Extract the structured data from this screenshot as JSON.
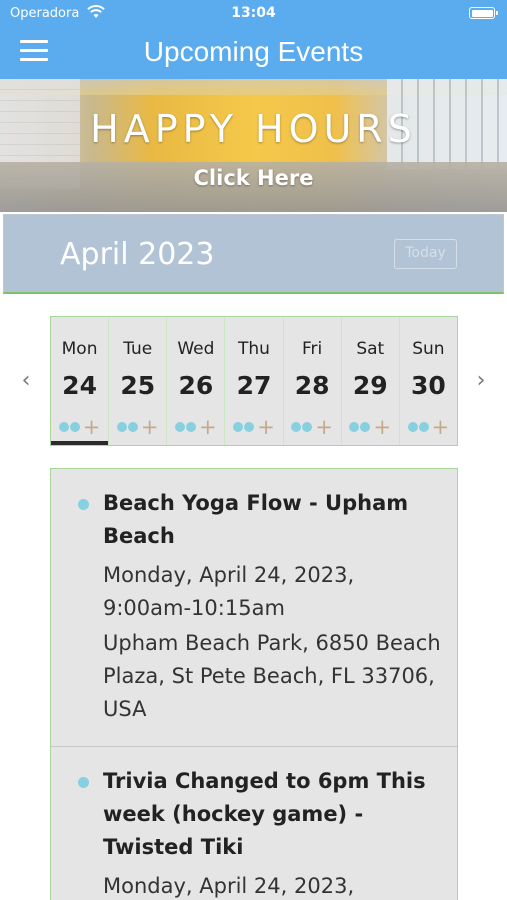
{
  "status_bar": {
    "carrier": "Operadora",
    "time": "13:04"
  },
  "nav": {
    "title": "Upcoming Events"
  },
  "banner": {
    "title": "HAPPY HOURS",
    "cta": "Click Here"
  },
  "calendar": {
    "month": "April 2023",
    "today_label": "Today",
    "days": [
      {
        "name": "Mon",
        "num": "24",
        "selected": true
      },
      {
        "name": "Tue",
        "num": "25"
      },
      {
        "name": "Wed",
        "num": "26"
      },
      {
        "name": "Thu",
        "num": "27"
      },
      {
        "name": "Fri",
        "num": "28"
      },
      {
        "name": "Sat",
        "num": "29"
      },
      {
        "name": "Sun",
        "num": "30"
      }
    ],
    "plus_symbol": "+"
  },
  "events": [
    {
      "title": "Beach Yoga Flow - Upham Beach",
      "date": "Monday, April 24, 2023, 9:00am-10:15am",
      "location": "Upham Beach Park, 6850 Beach Plaza, St Pete Beach, FL 33706, USA"
    },
    {
      "title": "Trivia Changed to 6pm This week (hockey game) - Twisted Tiki",
      "date": "Monday, April 24, 2023,"
    }
  ],
  "colors": {
    "accent": "#5aacee",
    "month_bar": "#b2c3d5",
    "event_dot": "#87d0e0",
    "plus": "#c4a98b",
    "border_green": "#a7d79a"
  }
}
